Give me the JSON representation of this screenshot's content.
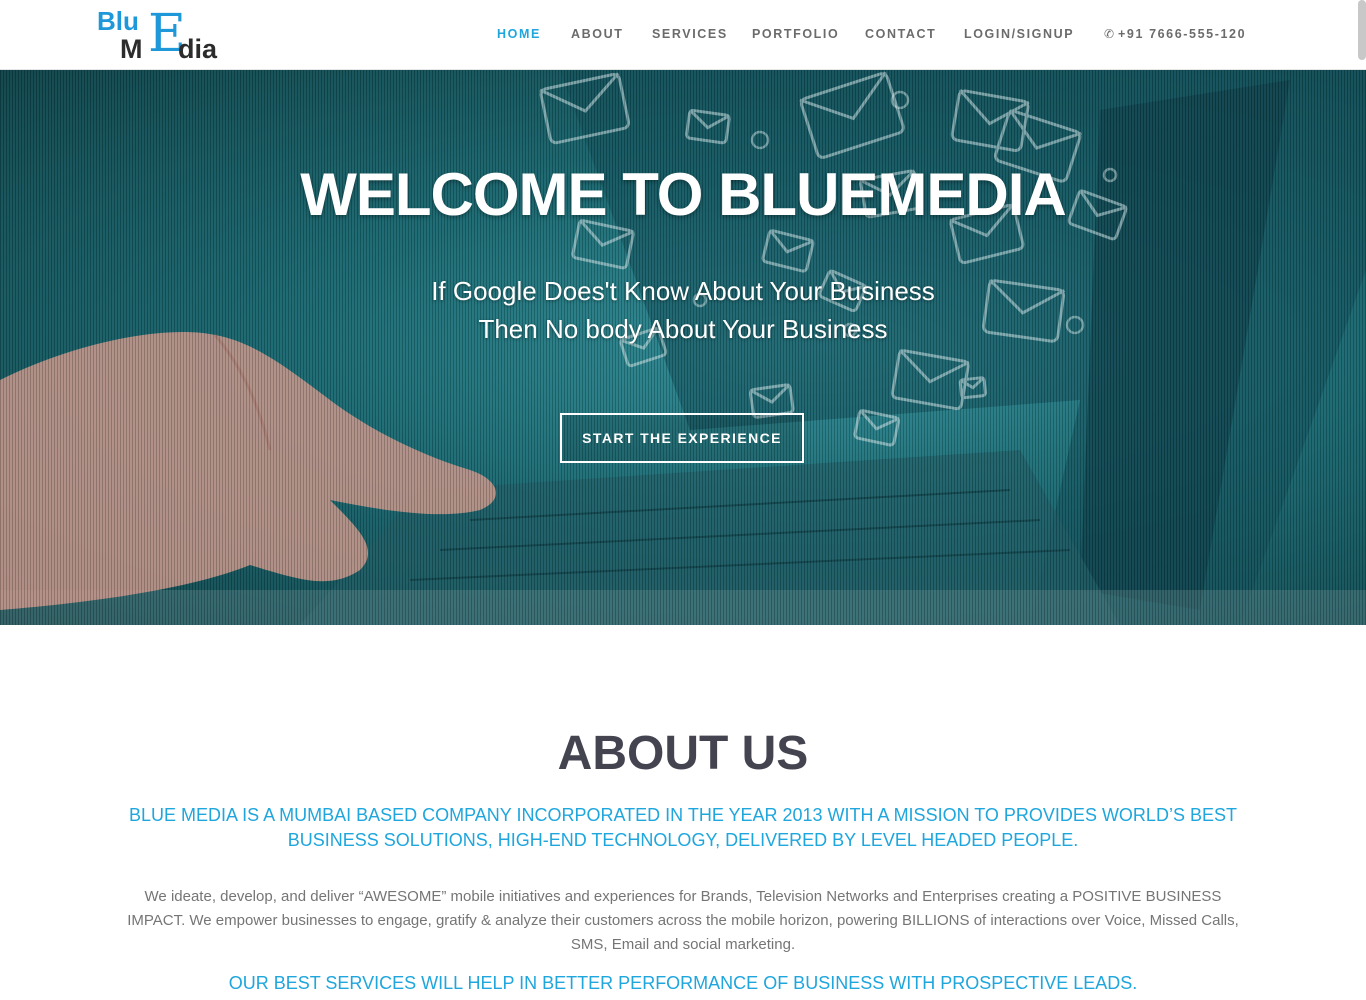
{
  "logo": {
    "part1": "Blu",
    "part2": "M",
    "part3": "E",
    "part4": "dia"
  },
  "nav": {
    "items": [
      {
        "label": "HOME",
        "active": true
      },
      {
        "label": "ABOUT",
        "active": false
      },
      {
        "label": "SERVICES",
        "active": false
      },
      {
        "label": "PORTFOLIO",
        "active": false
      },
      {
        "label": "CONTACT",
        "active": false
      },
      {
        "label": "LOGIN/SIGNUP",
        "active": false
      }
    ],
    "phone": "+91 7666-555-120",
    "phone_icon": "phone-icon"
  },
  "hero": {
    "title": "WELCOME TO BLUEMEDIA",
    "subtitle_line1": "If Google Does't Know About Your Business",
    "subtitle_line2": "Then No body About Your Business",
    "button_label": "START THE EXPERIENCE"
  },
  "about": {
    "title": "ABOUT US",
    "lead": "BLUE MEDIA IS A MUMBAI BASED COMPANY INCORPORATED IN THE YEAR 2013 WITH A MISSION TO PROVIDES WORLD’S BEST BUSINESS SOLUTIONS, HIGH-END TECHNOLOGY, DELIVERED BY LEVEL HEADED PEOPLE.",
    "body": "We ideate, develop, and deliver “AWESOME” mobile initiatives and experiences for Brands, Television Networks and Enterprises creating a POSITIVE BUSINESS IMPACT. We empower businesses to engage, gratify & analyze their customers across the mobile horizon, powering BILLIONS of interactions over Voice, Missed Calls, SMS, Email and social marketing.",
    "lead2": "OUR BEST SERVICES WILL HELP IN BETTER PERFORMANCE OF BUSINESS WITH PROSPECTIVE LEADS."
  },
  "colors": {
    "accent": "#1ea6dd",
    "heading": "#444451",
    "body_text": "#757575",
    "hero_teal": "#186770"
  }
}
